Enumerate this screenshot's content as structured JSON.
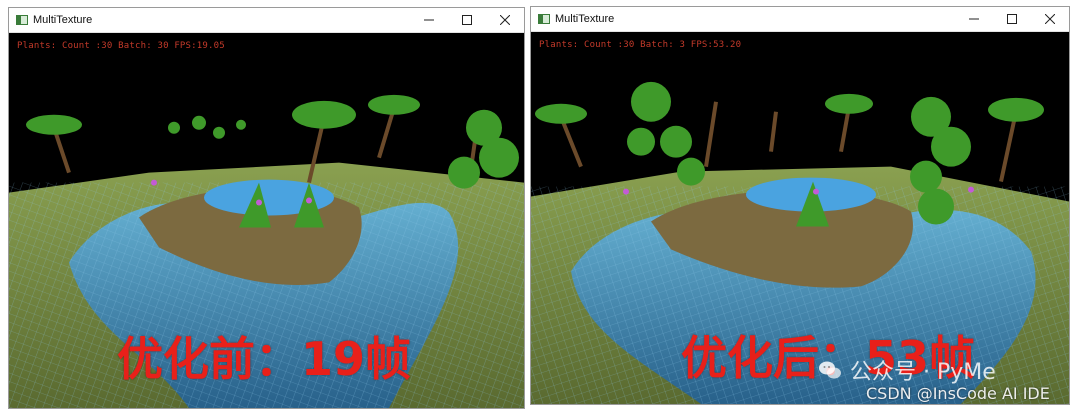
{
  "left_window": {
    "title": "MultiTexture",
    "hud": "Plants: Count :30 Batch: 30 FPS:19.05",
    "caption": "优化前：19帧"
  },
  "right_window": {
    "title": "MultiTexture",
    "hud": "Plants: Count :30 Batch: 3 FPS:53.20",
    "caption": "优化后：53帧"
  },
  "window_controls": {
    "minimize": "—",
    "maximize": "☐",
    "close": "✕"
  },
  "watermark": {
    "line1": "公众号 · PyMe",
    "line2": "CSDN @InsCode AI IDE",
    "logo_icon": "wechat-icon"
  },
  "colors": {
    "hud_text": "#c43a2a",
    "caption": "#e8201a",
    "terrain": "#6b5a3a",
    "water": "#3a8fc8",
    "foliage": "#3f9a2a"
  }
}
